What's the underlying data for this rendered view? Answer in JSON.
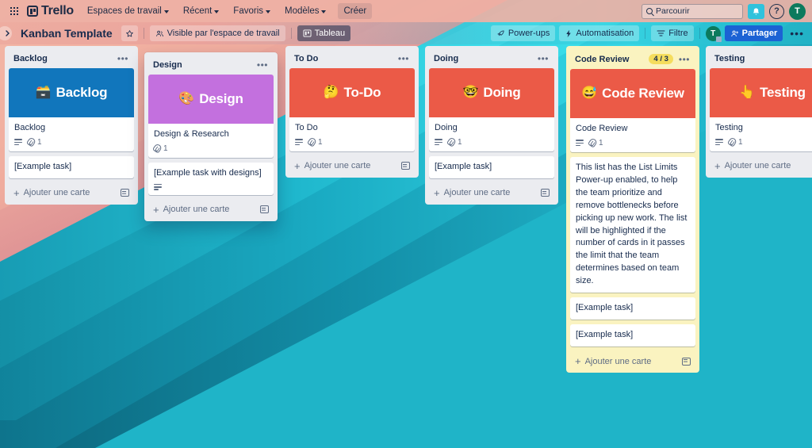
{
  "top_nav": {
    "apps_icon": "grid-apps-icon",
    "brand": "Trello",
    "items": [
      {
        "label": "Espaces de travail",
        "has_caret": true
      },
      {
        "label": "Récent",
        "has_caret": true
      },
      {
        "label": "Favoris",
        "has_caret": true
      },
      {
        "label": "Modèles",
        "has_caret": true
      }
    ],
    "create_label": "Créer",
    "search_placeholder": "Parcourir",
    "search_value": "",
    "notification_icon": "bell-icon",
    "help_icon": "question-mark-icon",
    "help_label": "?",
    "avatar_initial": "T"
  },
  "board_header": {
    "sidebar_toggle_icon": "chevron-right-icon",
    "title": "Kanban Template",
    "star_icon": "star-icon",
    "visibility_icon": "workspace-icon",
    "visibility_label": "Visible par l'espace de travail",
    "view_icon": "board-view-icon",
    "view_label": "Tableau",
    "view_caret_icon": "chevron-down-icon",
    "powerups_icon": "rocket-icon",
    "powerups_label": "Power-ups",
    "automation_icon": "lightning-icon",
    "automation_label": "Automatisation",
    "filter_icon": "filter-icon",
    "filter_label": "Filtre",
    "member_initial": "T",
    "share_icon": "person-add-icon",
    "share_label": "Partager",
    "more_icon": "more-horizontal-icon",
    "more_label": "•••"
  },
  "colors": {
    "cover_blue": "#1176BC",
    "cover_purple": "#C370DE",
    "cover_red": "#EB5A47",
    "list_bg": "#EBECF0",
    "list_bg_limited": "#FAF3C0",
    "limit_badge": "#F5DD5D",
    "share_blue": "#1B62D4",
    "avatar_green": "#0C7A5D",
    "notification_cyan": "#2FC2DC",
    "text_dark": "#172B4D",
    "text_muted": "#5E6C84"
  },
  "add_card_label": "Ajouter une carte",
  "list_menu_label": "•••",
  "template_icon": "card-template-icon",
  "lists": [
    {
      "name": "Backlog",
      "limit_badge": null,
      "lifted": false,
      "limited": false,
      "cards": [
        {
          "cover_color": "#1176BC",
          "cover_emoji": "🗃️",
          "cover_text": "Backlog",
          "title": "Backlog",
          "has_description": true,
          "attachments": "1"
        },
        {
          "title": "[Example task]",
          "has_description": false,
          "attachments": null
        }
      ]
    },
    {
      "name": "Design",
      "limit_badge": null,
      "lifted": true,
      "limited": false,
      "cards": [
        {
          "cover_color": "#C370DE",
          "cover_emoji": "🎨",
          "cover_text": "Design",
          "title": "Design & Research",
          "has_description": false,
          "attachments": "1"
        },
        {
          "title": "[Example task with designs]",
          "has_description": true,
          "attachments": null
        }
      ]
    },
    {
      "name": "To Do",
      "limit_badge": null,
      "lifted": false,
      "limited": false,
      "cards": [
        {
          "cover_color": "#EB5A47",
          "cover_emoji": "🤔",
          "cover_text": "To-Do",
          "title": "To Do",
          "has_description": true,
          "attachments": "1"
        }
      ]
    },
    {
      "name": "Doing",
      "limit_badge": null,
      "lifted": false,
      "limited": false,
      "cards": [
        {
          "cover_color": "#EB5A47",
          "cover_emoji": "🤓",
          "cover_text": "Doing",
          "title": "Doing",
          "has_description": true,
          "attachments": "1"
        },
        {
          "title": "[Example task]",
          "has_description": false,
          "attachments": null
        }
      ]
    },
    {
      "name": "Code Review",
      "limit_badge": "4 / 3",
      "lifted": false,
      "limited": true,
      "cards": [
        {
          "cover_color": "#EB5A47",
          "cover_emoji": "😅",
          "cover_text": "Code Review",
          "title": "Code Review",
          "has_description": true,
          "attachments": "1"
        },
        {
          "title": "This list has the List Limits Power-up enabled, to help the team prioritize and remove bottlenecks before picking up new work. The list will be highlighted if the number of cards in it passes the limit that the team determines based on team size.",
          "has_description": false,
          "attachments": null
        },
        {
          "title": "[Example task]",
          "has_description": false,
          "attachments": null
        },
        {
          "title": "[Example task]",
          "has_description": false,
          "attachments": null
        }
      ]
    },
    {
      "name": "Testing",
      "limit_badge": null,
      "lifted": false,
      "limited": false,
      "cards": [
        {
          "cover_color": "#EB5A47",
          "cover_emoji": "👆",
          "cover_text": "Testing",
          "title": "Testing",
          "has_description": true,
          "attachments": "1"
        }
      ]
    }
  ]
}
